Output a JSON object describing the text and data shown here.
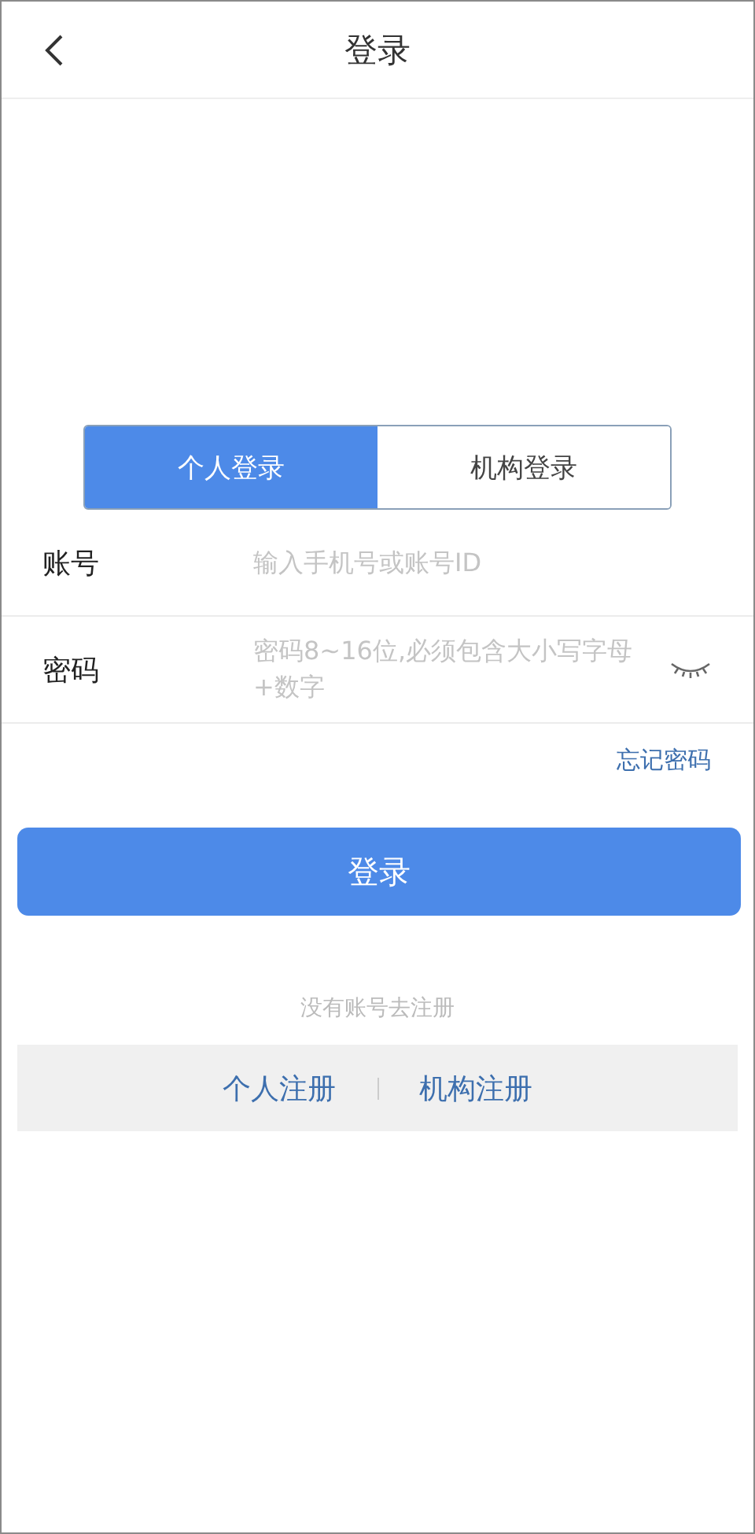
{
  "header": {
    "title": "登录"
  },
  "tabs": [
    {
      "label": "个人登录",
      "selected": true
    },
    {
      "label": "机构登录",
      "selected": false
    }
  ],
  "fields": [
    {
      "label": "账号",
      "placeholder": "输入手机号或账号ID",
      "kind": "text"
    },
    {
      "label": "密码",
      "placeholder": "密码8~16位,必须包含大小写字母+数字",
      "kind": "password"
    }
  ],
  "forgot_link": "忘记密码",
  "login_button": "登录",
  "register_hint": "没有账号去注册",
  "register_links": [
    "个人注册",
    "机构注册"
  ]
}
